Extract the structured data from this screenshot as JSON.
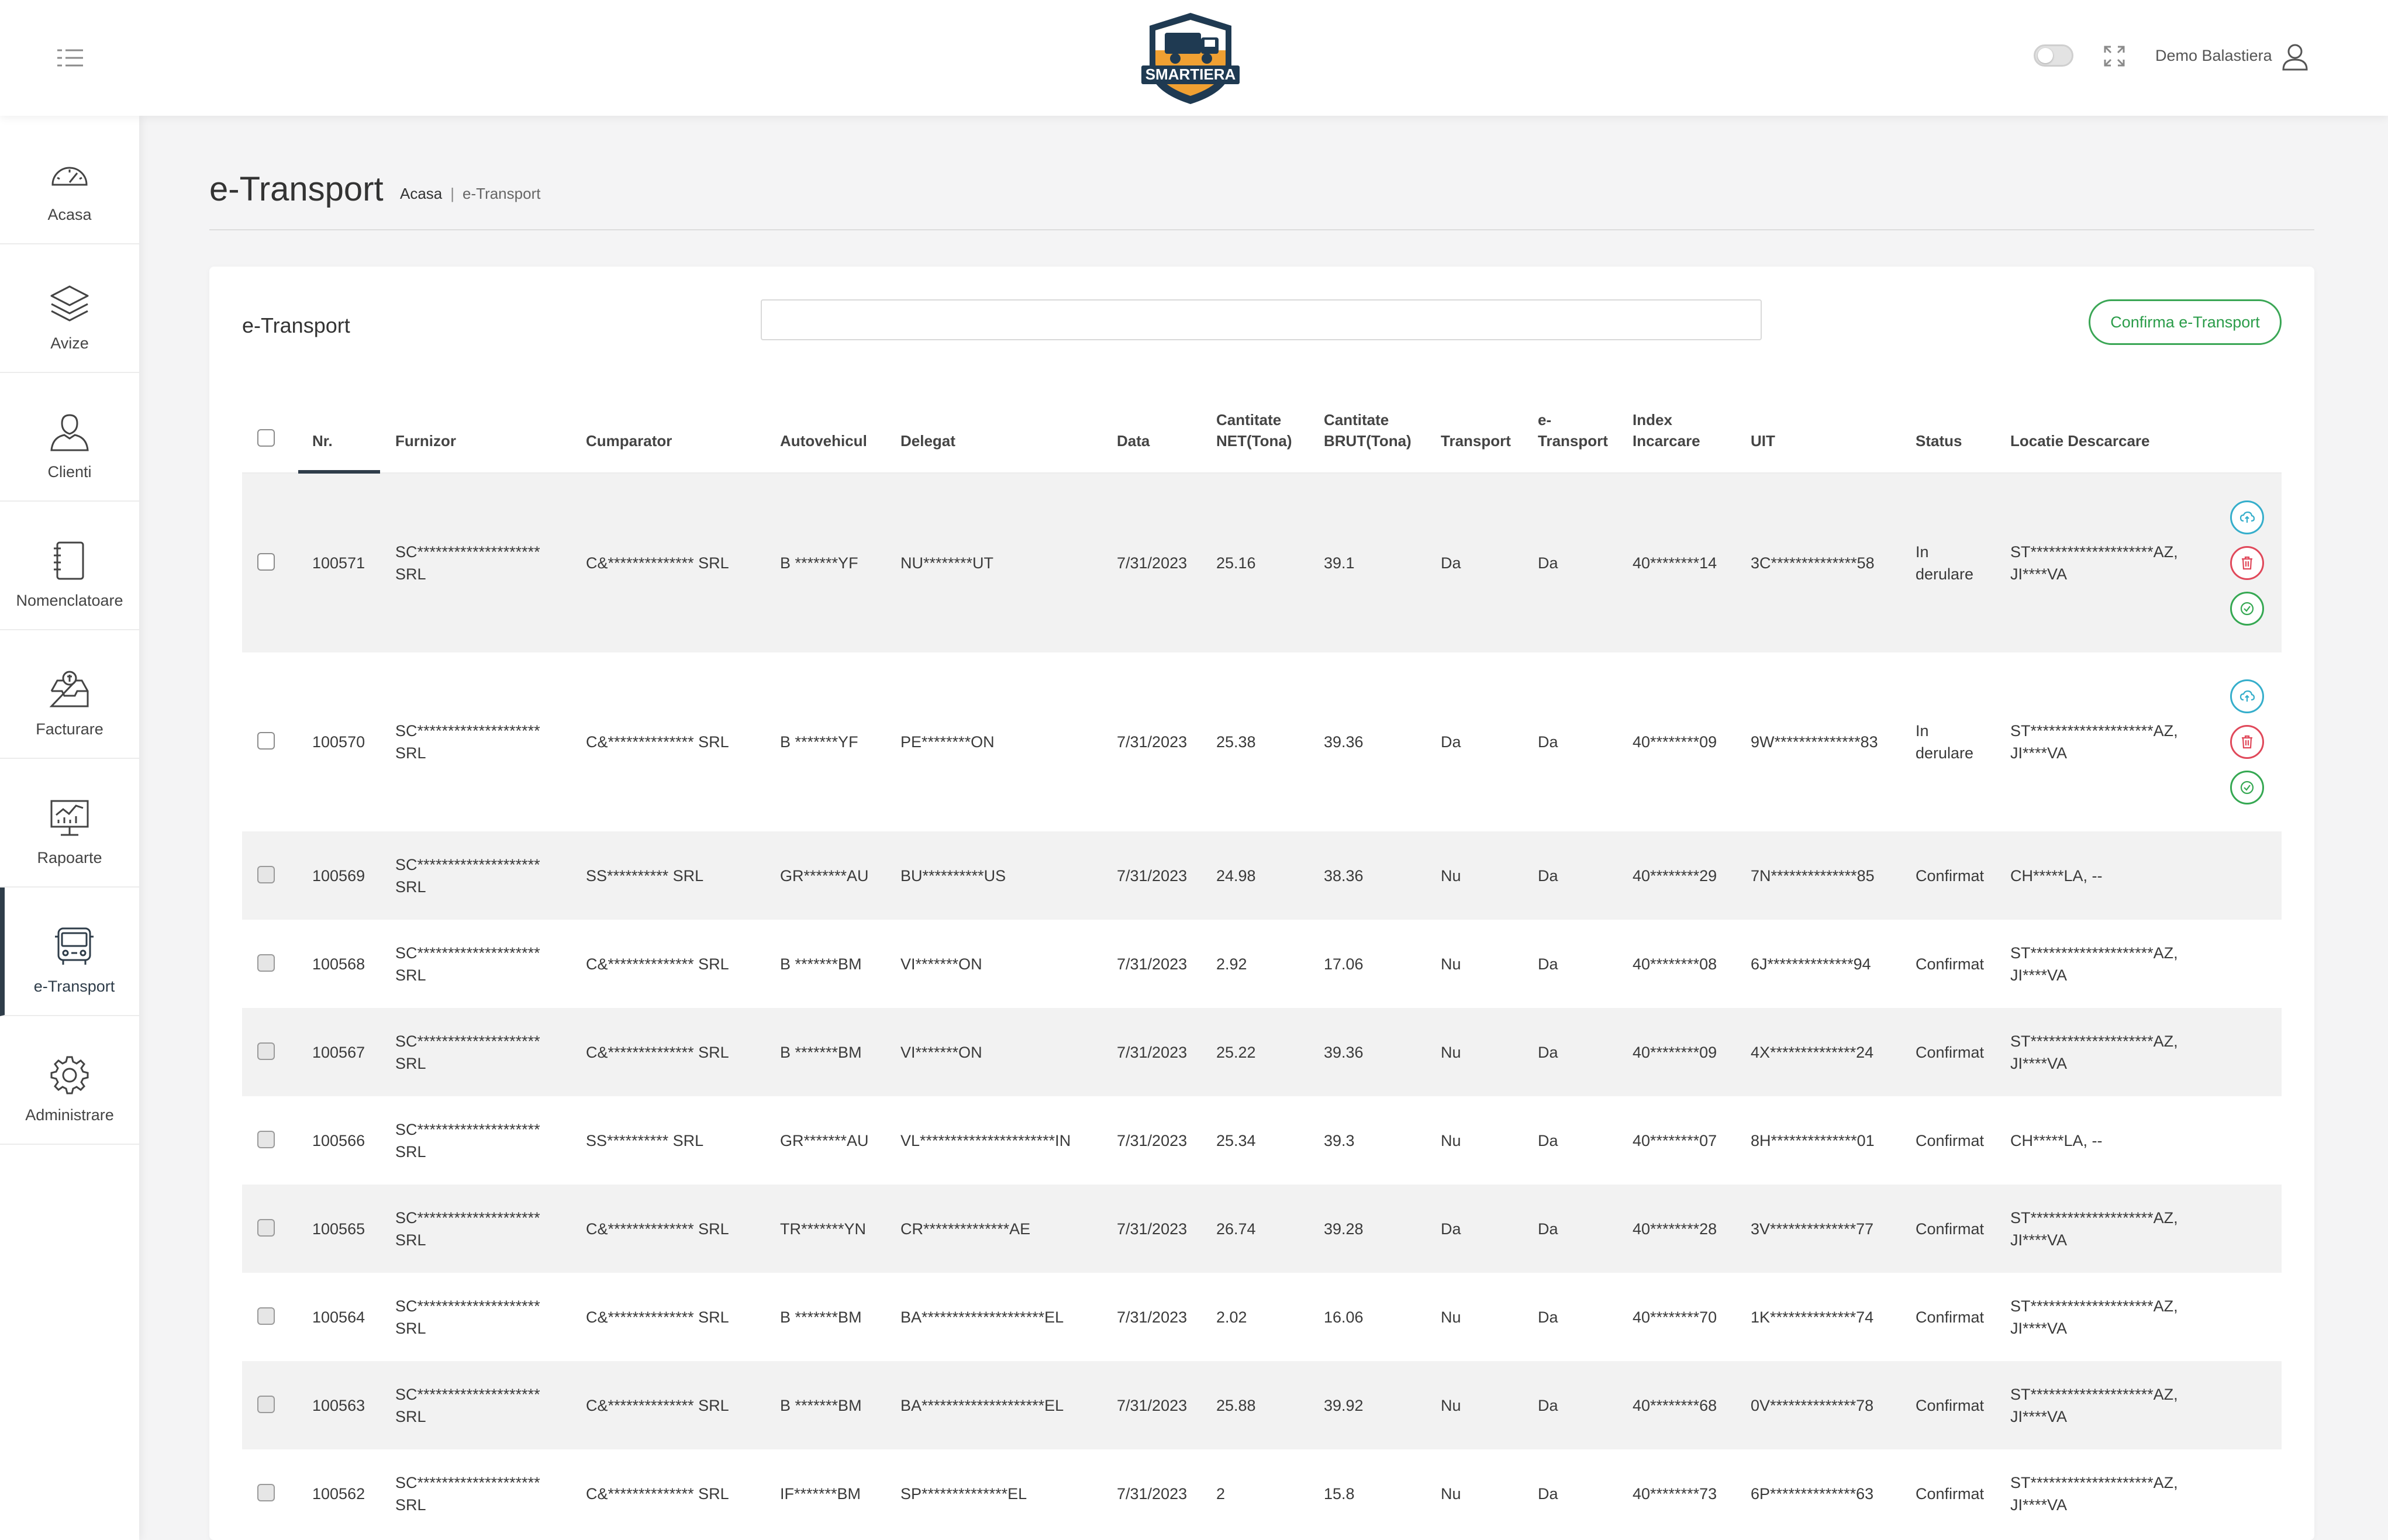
{
  "app": {
    "brand": "SMARTIERA",
    "user_name": "Demo Balastiera",
    "colors": {
      "accent_green": "#3aa655",
      "sidebar_active": "#2f3d4a",
      "danger": "#e0485a",
      "info": "#35aecb"
    }
  },
  "sidebar": {
    "items": [
      {
        "label": "Acasa",
        "icon": "speedometer-icon"
      },
      {
        "label": "Avize",
        "icon": "layers-icon"
      },
      {
        "label": "Clienti",
        "icon": "user-icon"
      },
      {
        "label": "Nomenclatoare",
        "icon": "notebook-icon"
      },
      {
        "label": "Facturare",
        "icon": "inbox-icon"
      },
      {
        "label": "Rapoarte",
        "icon": "chart-board-icon"
      },
      {
        "label": "e-Transport",
        "icon": "bus-icon",
        "active": true
      },
      {
        "label": "Administrare",
        "icon": "gear-icon"
      }
    ]
  },
  "page": {
    "title": "e-Transport",
    "breadcrumb": {
      "home": "Acasa",
      "current": "e-Transport"
    }
  },
  "card": {
    "title": "e-Transport",
    "search": {
      "value": "",
      "placeholder": ""
    },
    "confirm_label": "Confirma e-Transport"
  },
  "table": {
    "headers": {
      "nr": "Nr.",
      "furnizor": "Furnizor",
      "cumparator": "Cumparator",
      "autovehicul": "Autovehicul",
      "delegat": "Delegat",
      "data": "Data",
      "cant_net_1": "Cantitate",
      "cant_net_2": "NET(Tona)",
      "cant_brut_1": "Cantitate",
      "cant_brut_2": "BRUT(Tona)",
      "transport": "Transport",
      "etransport_1": "e-",
      "etransport_2": "Transport",
      "index_1": "Index",
      "index_2": "Incarcare",
      "uit": "UIT",
      "status": "Status",
      "locatie": "Locatie Descarcare"
    },
    "rows": [
      {
        "nr": "100571",
        "furnizor_1": "SC********************",
        "furnizor_2": "SRL",
        "cumparator": "C&************** SRL",
        "autovehicul": "B *******YF",
        "delegat": "NU********UT",
        "data": "7/31/2023",
        "net": "25.16",
        "brut": "39.1",
        "transport": "Da",
        "etransport": "Da",
        "index": "40********14",
        "uit": "3C**************58",
        "status_1": "In",
        "status_2": "derulare",
        "locatie_1": "ST********************AZ,",
        "locatie_2": "JI****VA"
      },
      {
        "nr": "100570",
        "furnizor_1": "SC********************",
        "furnizor_2": "SRL",
        "cumparator": "C&************** SRL",
        "autovehicul": "B *******YF",
        "delegat": "PE********ON",
        "data": "7/31/2023",
        "net": "25.38",
        "brut": "39.36",
        "transport": "Da",
        "etransport": "Da",
        "index": "40********09",
        "uit": "9W**************83",
        "status_1": "In",
        "status_2": "derulare",
        "locatie_1": "ST********************AZ,",
        "locatie_2": "JI****VA"
      },
      {
        "nr": "100569",
        "furnizor_1": "SC********************",
        "furnizor_2": "SRL",
        "cumparator": "SS********** SRL",
        "autovehicul": "GR*******AU",
        "delegat": "BU**********US",
        "data": "7/31/2023",
        "net": "24.98",
        "brut": "38.36",
        "transport": "Nu",
        "etransport": "Da",
        "index": "40********29",
        "uit": "7N**************85",
        "status_1": "Confirmat",
        "status_2": "",
        "locatie_1": "CH*****LA, --",
        "locatie_2": ""
      },
      {
        "nr": "100568",
        "furnizor_1": "SC********************",
        "furnizor_2": "SRL",
        "cumparator": "C&************** SRL",
        "autovehicul": "B *******BM",
        "delegat": "VI*******ON",
        "data": "7/31/2023",
        "net": "2.92",
        "brut": "17.06",
        "transport": "Nu",
        "etransport": "Da",
        "index": "40********08",
        "uit": "6J**************94",
        "status_1": "Confirmat",
        "status_2": "",
        "locatie_1": "ST********************AZ,",
        "locatie_2": "JI****VA"
      },
      {
        "nr": "100567",
        "furnizor_1": "SC********************",
        "furnizor_2": "SRL",
        "cumparator": "C&************** SRL",
        "autovehicul": "B *******BM",
        "delegat": "VI*******ON",
        "data": "7/31/2023",
        "net": "25.22",
        "brut": "39.36",
        "transport": "Nu",
        "etransport": "Da",
        "index": "40********09",
        "uit": "4X**************24",
        "status_1": "Confirmat",
        "status_2": "",
        "locatie_1": "ST********************AZ,",
        "locatie_2": "JI****VA"
      },
      {
        "nr": "100566",
        "furnizor_1": "SC********************",
        "furnizor_2": "SRL",
        "cumparator": "SS********** SRL",
        "autovehicul": "GR*******AU",
        "delegat": "VL**********************IN",
        "data": "7/31/2023",
        "net": "25.34",
        "brut": "39.3",
        "transport": "Nu",
        "etransport": "Da",
        "index": "40********07",
        "uit": "8H**************01",
        "status_1": "Confirmat",
        "status_2": "",
        "locatie_1": "CH*****LA, --",
        "locatie_2": ""
      },
      {
        "nr": "100565",
        "furnizor_1": "SC********************",
        "furnizor_2": "SRL",
        "cumparator": "C&************** SRL",
        "autovehicul": "TR*******YN",
        "delegat": "CR**************AE",
        "data": "7/31/2023",
        "net": "26.74",
        "brut": "39.28",
        "transport": "Da",
        "etransport": "Da",
        "index": "40********28",
        "uit": "3V**************77",
        "status_1": "Confirmat",
        "status_2": "",
        "locatie_1": "ST********************AZ,",
        "locatie_2": "JI****VA"
      },
      {
        "nr": "100564",
        "furnizor_1": "SC********************",
        "furnizor_2": "SRL",
        "cumparator": "C&************** SRL",
        "autovehicul": "B *******BM",
        "delegat": "BA********************EL",
        "data": "7/31/2023",
        "net": "2.02",
        "brut": "16.06",
        "transport": "Nu",
        "etransport": "Da",
        "index": "40********70",
        "uit": "1K**************74",
        "status_1": "Confirmat",
        "status_2": "",
        "locatie_1": "ST********************AZ,",
        "locatie_2": "JI****VA"
      },
      {
        "nr": "100563",
        "furnizor_1": "SC********************",
        "furnizor_2": "SRL",
        "cumparator": "C&************** SRL",
        "autovehicul": "B *******BM",
        "delegat": "BA********************EL",
        "data": "7/31/2023",
        "net": "25.88",
        "brut": "39.92",
        "transport": "Nu",
        "etransport": "Da",
        "index": "40********68",
        "uit": "0V**************78",
        "status_1": "Confirmat",
        "status_2": "",
        "locatie_1": "ST********************AZ,",
        "locatie_2": "JI****VA"
      },
      {
        "nr": "100562",
        "furnizor_1": "SC********************",
        "furnizor_2": "SRL",
        "cumparator": "C&************** SRL",
        "autovehicul": "IF*******BM",
        "delegat": "SP**************EL",
        "data": "7/31/2023",
        "net": "2",
        "brut": "15.8",
        "transport": "Nu",
        "etransport": "Da",
        "index": "40********73",
        "uit": "6P**************63",
        "status_1": "Confirmat",
        "status_2": "",
        "locatie_1": "ST********************AZ,",
        "locatie_2": "JI****VA"
      }
    ]
  }
}
